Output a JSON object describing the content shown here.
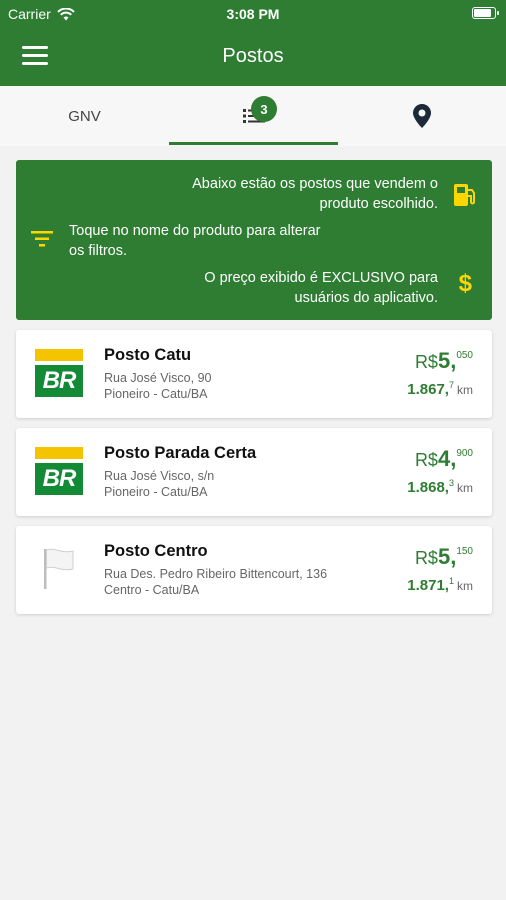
{
  "status_bar": {
    "carrier": "Carrier",
    "time": "3:08 PM",
    "battery_level": 0.9
  },
  "nav": {
    "title": "Postos",
    "menu_icon": "hamburger-menu-icon"
  },
  "tabs": {
    "gnv_label": "GNV",
    "list_badge": "3",
    "list_icon": "list-icon",
    "map_icon": "map-pin-icon",
    "active": "list"
  },
  "info": {
    "line1": "Abaixo estão os postos que vendem o produto escolhido.",
    "line2": "Toque no nome do produto para alterar os filtros.",
    "line3": "O preço exibido é EXCLUSIVO para usuários do aplicativo.",
    "dollar": "$",
    "fuel_icon": "fuel-pump-icon",
    "filter_icon": "filter-icon",
    "dollar_icon": "dollar-icon",
    "accent": "#2e7d32",
    "highlight": "#ffd600"
  },
  "stations": [
    {
      "name": "Posto Catu",
      "address1": "Rua José Visco, 90",
      "address2": "Pioneiro - Catu/BA",
      "logo": "br-logo",
      "logo_text": "BR",
      "currency": "R$",
      "price_int": "5,",
      "price_dec": "050",
      "dist_int": "1.867,",
      "dist_dec": "7",
      "dist_unit": "km"
    },
    {
      "name": "Posto Parada Certa",
      "address1": "Rua José Visco, s/n",
      "address2": "Pioneiro - Catu/BA",
      "logo": "br-logo",
      "logo_text": "BR",
      "currency": "R$",
      "price_int": "4,",
      "price_dec": "900",
      "dist_int": "1.868,",
      "dist_dec": "3",
      "dist_unit": "km"
    },
    {
      "name": "Posto Centro",
      "address1": "Rua Des. Pedro Ribeiro Bittencourt, 136",
      "address2": "Centro - Catu/BA",
      "logo": "white-flag-icon",
      "currency": "R$",
      "price_int": "5,",
      "price_dec": "150",
      "dist_int": "1.871,",
      "dist_dec": "1",
      "dist_unit": "km"
    }
  ]
}
